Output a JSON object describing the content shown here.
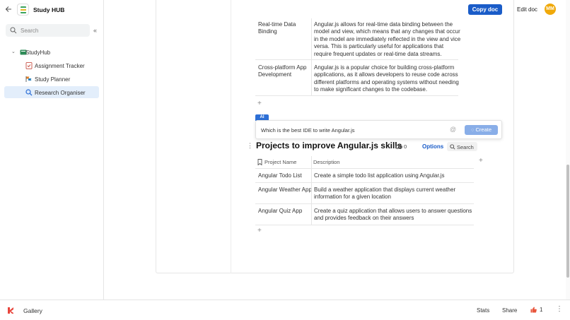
{
  "header": {
    "doc_title": "Study HUB",
    "copy_doc_label": "Copy doc",
    "edit_doc_label": "Edit doc",
    "avatar_initials": "MM"
  },
  "sidebar": {
    "search_placeholder": "Search",
    "items": [
      {
        "label": "StudyHub",
        "icon": "book-icon"
      },
      {
        "label": "Assignment Tracker",
        "icon": "checklist-icon"
      },
      {
        "label": "Study Planner",
        "icon": "flags-icon"
      },
      {
        "label": "Research Organiser",
        "icon": "magnifier-icon",
        "active": true
      }
    ]
  },
  "top_table": {
    "rows": [
      {
        "name": [
          "Real-time Data",
          "Binding"
        ],
        "description": [
          "Angular.js allows for real-time data binding between the",
          "model and view, which means that any changes that occur",
          "in the model are immediately reflected in the view and vice",
          "versa. This is particularly useful for applications that",
          "require frequent updates or real-time data streams."
        ]
      },
      {
        "name": [
          "Cross-platform App",
          "Development"
        ],
        "description": [
          "Angular.js is a popular choice for building cross-platform",
          "applications, as it allows developers to reuse code across",
          "different platforms and operating systems without needing",
          "to make significant changes to the codebase."
        ]
      }
    ]
  },
  "ai": {
    "tag": "AI",
    "prompt": "Which is the best IDE to write Angular.js",
    "create_label": "Create"
  },
  "section": {
    "title": "Projects to improve Angular.js skills",
    "link_count": "0",
    "options_label": "Options",
    "search_label": "Search"
  },
  "projects_table": {
    "headers": [
      "Project Name",
      "Description"
    ],
    "rows": [
      {
        "name": "Angular Todo List",
        "description": [
          "Create a simple todo list application using Angular.js"
        ]
      },
      {
        "name": "Angular Weather App",
        "description": [
          "Build a weather application that displays current weather",
          "information for a given location"
        ]
      },
      {
        "name": "Angular Quiz App",
        "description": [
          "Create a quiz application that allows users to answer questions",
          "and provides feedback on their answers"
        ]
      }
    ]
  },
  "bottombar": {
    "gallery_label": "Gallery",
    "stats_label": "Stats",
    "share_label": "Share",
    "like_count": "1"
  },
  "colors": {
    "primary": "#1a5cc8",
    "avatar": "#f0a90a",
    "active_item": "#e3eefb"
  }
}
